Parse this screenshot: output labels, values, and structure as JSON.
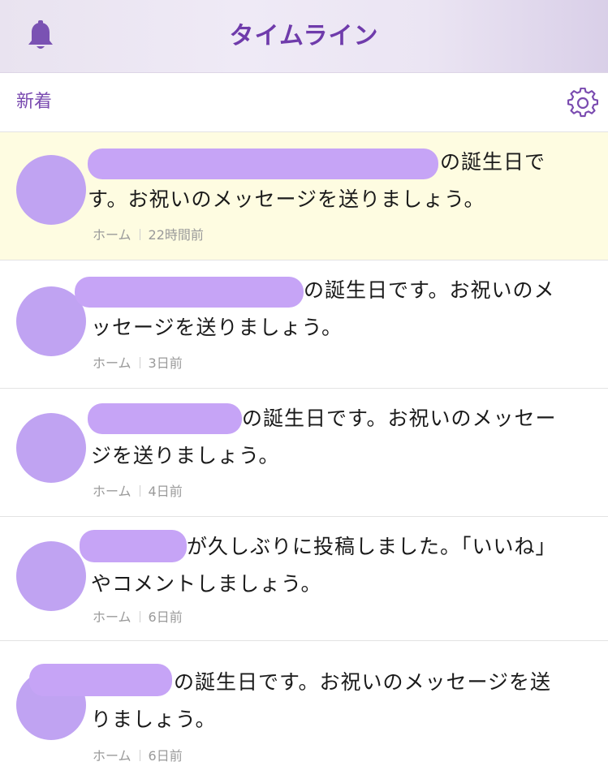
{
  "header": {
    "title": "タイムライン",
    "bell_icon": "bell-icon"
  },
  "subheader": {
    "label": "新着",
    "settings_icon": "gear-icon"
  },
  "timeline": [
    {
      "text_first": "の誕生日で",
      "text_rest": "す。お祝いのメッセージを送りましょう。",
      "source": "ホーム",
      "time": "22時間前"
    },
    {
      "text_first": "の誕生日です。お祝いのメ",
      "text_rest": "ッセージを送りましょう。",
      "source": "ホーム",
      "time": "3日前"
    },
    {
      "text_first": "の誕生日です。お祝いのメッセー",
      "text_rest": "ジを送りましょう。",
      "source": "ホーム",
      "time": "4日前"
    },
    {
      "text_first": "が久しぶりに投稿しました。「いいね」",
      "text_rest": "やコメントしましょう。",
      "source": "ホーム",
      "time": "6日前"
    },
    {
      "text_first": "の誕生日です。お祝いのメッセージを送",
      "text_rest": "りましょう。",
      "source": "ホーム",
      "time": "6日前"
    }
  ],
  "colors": {
    "accent": "#6f3bab",
    "highlight_bg": "#fefce1",
    "redaction": "#c6a4f6"
  }
}
